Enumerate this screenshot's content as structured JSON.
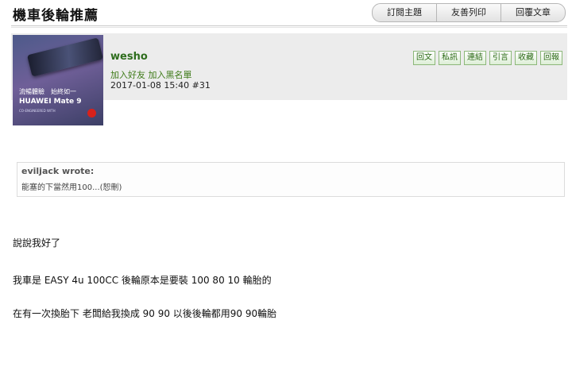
{
  "thread": {
    "title": "機車後輪推薦",
    "actions": [
      "訂閱主題",
      "友善列印",
      "回覆文章"
    ]
  },
  "post": {
    "avatar": {
      "line1": "流暢體驗　始終如一",
      "line2": "HUAWEI Mate 9",
      "line3": "CO-ENGINEERED WITH"
    },
    "author": "wesho",
    "add_friend": "加入好友",
    "add_blacklist": "加入黑名單",
    "meta": "2017-01-08 15:40  #31",
    "actions": [
      "回文",
      "私訊",
      "連結",
      "引言",
      "收藏",
      "回報"
    ]
  },
  "quote": {
    "author": "eviljack wrote:",
    "text": "能塞的下當然用100...(恕刪)"
  },
  "body": [
    "說說我好了",
    "我車是 EASY 4u 100CC 後輪原本是要裝 100 80 10 輪胎的",
    "在有一次換胎下 老闆給我換成 90 90 以後後輪都用90 90輪胎"
  ]
}
